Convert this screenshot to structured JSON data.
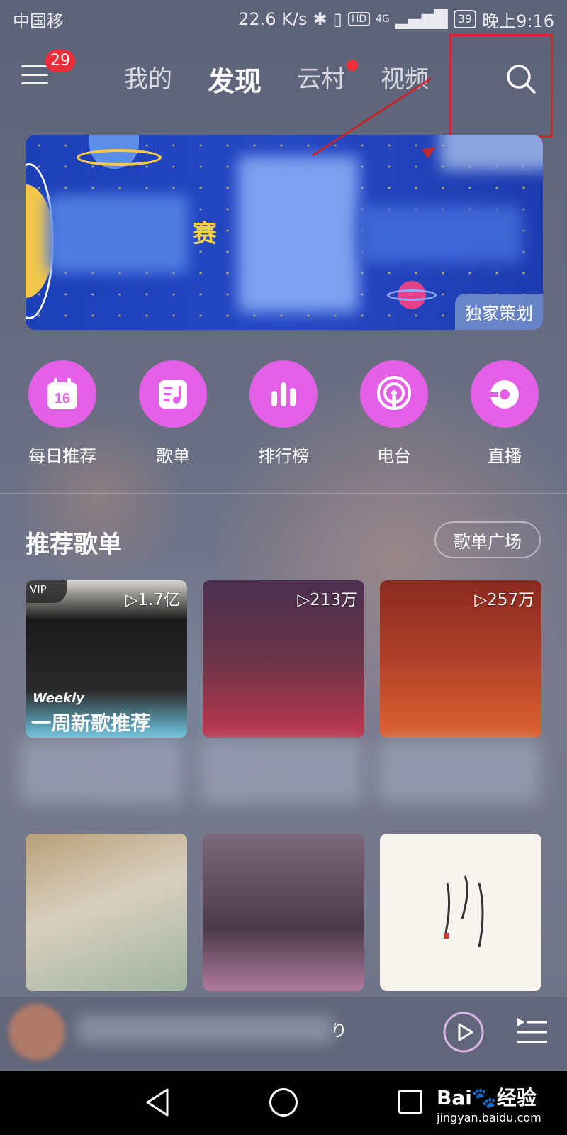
{
  "status_bar": {
    "carrier": "中国移",
    "network_speed": "22.6 K/s",
    "hd": "HD",
    "signal": "4G",
    "battery": "39",
    "time": "晚上9:16"
  },
  "header": {
    "notification_count": "29",
    "tabs": [
      {
        "label": "我的"
      },
      {
        "label": "发现"
      },
      {
        "label": "云村"
      },
      {
        "label": "视频"
      }
    ],
    "active_tab": "发现",
    "search_icon": "search-icon"
  },
  "banner": {
    "title_char": "赛",
    "tag": "独家策划"
  },
  "quick_actions": [
    {
      "label": "每日推荐",
      "icon": "calendar-icon",
      "icon_text": "16"
    },
    {
      "label": "歌单",
      "icon": "playlist-icon"
    },
    {
      "label": "排行榜",
      "icon": "chart-icon"
    },
    {
      "label": "电台",
      "icon": "radio-icon"
    },
    {
      "label": "直播",
      "icon": "live-icon"
    }
  ],
  "recommended": {
    "title": "推荐歌单",
    "more_button": "歌单广场",
    "cards": [
      {
        "play_count": "▷1.7亿",
        "vip": "VIP",
        "overlay_en": "Weekly",
        "overlay_cn": "一周新歌推荐"
      },
      {
        "play_count": "▷213万"
      },
      {
        "play_count": "▷257万"
      }
    ]
  },
  "player": {
    "partial_text": "り"
  },
  "watermark": {
    "main": "Bai🐾经验",
    "sub": "jingyan.baidu.com"
  },
  "colors": {
    "accent": "#e35fe6",
    "badge": "#ec2f3b",
    "highlight": "#d9242d"
  }
}
